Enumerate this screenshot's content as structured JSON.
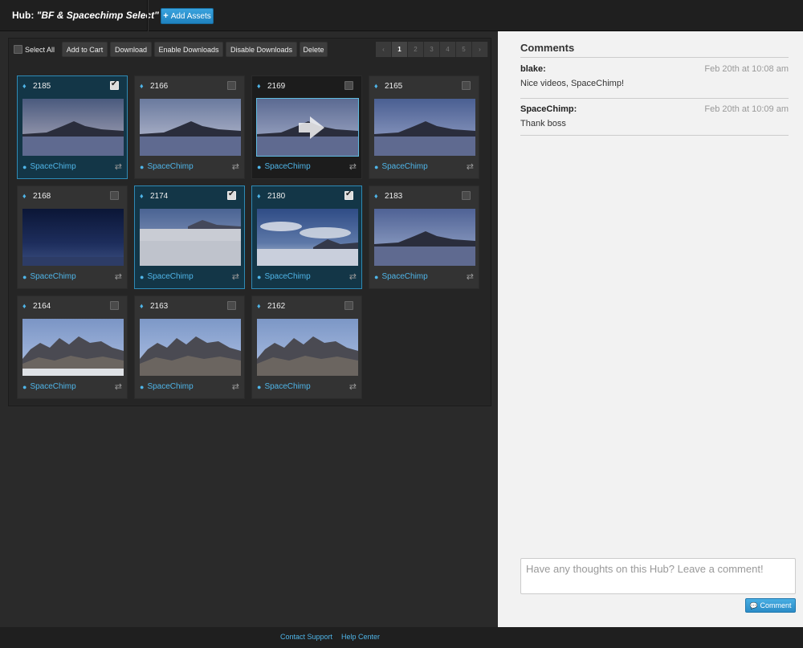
{
  "header": {
    "hub_label": "Hub:",
    "hub_name": "\"BF & Spacechimp Select\"",
    "add_assets_label": "Add Assets",
    "add_assets_icon": "plus-icon"
  },
  "toolbar": {
    "select_all_label": "Select All",
    "buttons": [
      "Add to Cart",
      "Download",
      "Enable Downloads",
      "Disable Downloads",
      "Delete"
    ],
    "pager": [
      "‹",
      "1",
      "2",
      "3",
      "4",
      "5",
      "›"
    ],
    "current_page": "1"
  },
  "assets": [
    {
      "id": "2185",
      "user": "SpaceChimp",
      "checked": true,
      "selected": true,
      "scene": "dusk-flat"
    },
    {
      "id": "2166",
      "user": "SpaceChimp",
      "checked": false,
      "selected": false,
      "scene": "mountain-flat"
    },
    {
      "id": "2169",
      "user": "SpaceChimp",
      "checked": false,
      "selected": false,
      "hover": true,
      "scene": "dusk-flat-arrow"
    },
    {
      "id": "2165",
      "user": "SpaceChimp",
      "checked": false,
      "selected": false,
      "scene": "dusk-low"
    },
    {
      "id": "2168",
      "user": "SpaceChimp",
      "checked": false,
      "selected": false,
      "scene": "night"
    },
    {
      "id": "2174",
      "user": "SpaceChimp",
      "checked": true,
      "selected": true,
      "scene": "salt-day"
    },
    {
      "id": "2180",
      "user": "SpaceChimp",
      "checked": true,
      "selected": true,
      "scene": "clouds"
    },
    {
      "id": "2183",
      "user": "SpaceChimp",
      "checked": false,
      "selected": false,
      "scene": "dusk-mid"
    },
    {
      "id": "2164",
      "user": "SpaceChimp",
      "checked": false,
      "selected": false,
      "scene": "peaks-snow"
    },
    {
      "id": "2163",
      "user": "SpaceChimp",
      "checked": false,
      "selected": false,
      "scene": "peaks"
    },
    {
      "id": "2162",
      "user": "SpaceChimp",
      "checked": false,
      "selected": false,
      "scene": "peaks-big"
    }
  ],
  "comments_panel": {
    "title": "Comments",
    "comments": [
      {
        "author": "blake:",
        "time": "Feb 20th at 10:08 am",
        "text": "Nice videos, SpaceChimp!"
      },
      {
        "author": "SpaceChimp:",
        "time": "Feb 20th at 10:09 am",
        "text": "Thank boss"
      }
    ],
    "input_placeholder": "Have any thoughts on this Hub? Leave a comment!",
    "submit_label": "Comment",
    "submit_icon": "speech-bubble-icon"
  },
  "footer": {
    "contact_label": "Contact Support",
    "help_label": "Help Center"
  },
  "colors": {
    "accent": "#4fb5e8",
    "selected_bg": "#133647",
    "panel_bg": "#f2f2f2"
  }
}
